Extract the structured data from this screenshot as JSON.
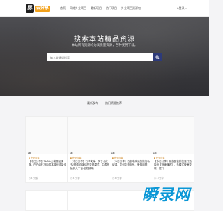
{
  "nav": {
    "logo_mark": "豚",
    "logo_text": "云分享",
    "menu": [
      "首页",
      "网络外业项目",
      "最新项目",
      "热门项目",
      "外业项目资源包"
    ],
    "login": "&登录 ○"
  },
  "hero": {
    "title": "搜索本站精品资源",
    "subtitle": "本站所有资源均为高质量资源，各种姿势下载。",
    "search_placeholder": "输入关键词搜索"
  },
  "tabs": [
    "最新发布",
    "热门资源推荐"
  ],
  "cards": [
    {
      "thumb_logo": "●豚",
      "tag": "■ 外业合集",
      "title": "【今日分享】TikTok全域爆品操盘，白白6天-7天0成本增长流量全",
      "meta": "◷ 47分钟"
    },
    {
      "thumb_logo": "●豚",
      "tag": "■ 外业合集",
      "title": "【今日分享】行李文案：关于小红书/视频/自媒体的变现模式，由零开始到大干百-全程攻略",
      "meta": "◷ 47分钟"
    },
    {
      "thumb_logo": "●豚",
      "tag": "■ 外业合集",
      "title": "【今日分享】西部电商派的微信私域课，如何引流起号、爱情朋圈",
      "meta": "◷ 47分钟"
    },
    {
      "thumb_logo": "●豚",
      "tag": "■ 外业合集",
      "title": "【今日分享】朋友圈营销快速打造吸粉【快速赚钱】，多模式快速变现，提升",
      "meta": "◷ 47分钟"
    }
  ],
  "watermark": "瞬录网",
  "colors": {
    "accent": "#f2a11b",
    "search_button": "#2d3a7a",
    "watermark": "#0b97d6"
  }
}
